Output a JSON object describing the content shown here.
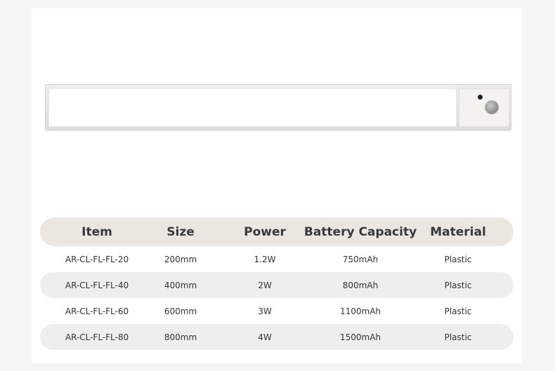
{
  "product_image": {
    "sensors": [
      "light-sensor-icon",
      "motion-sensor-icon"
    ]
  },
  "spec_table": {
    "headers": [
      "Item",
      "Size",
      "Power",
      "Battery Capacity",
      "Material"
    ],
    "rows": [
      [
        "AR-CL-FL-FL-20",
        "200mm",
        "1.2W",
        "750mAh",
        "Plastic"
      ],
      [
        "AR-CL-FL-FL-40",
        "400mm",
        "2W",
        "800mAh",
        "Plastic"
      ],
      [
        "AR-CL-FL-FL-60",
        "600mm",
        "3W",
        "1100mAh",
        "Plastic"
      ],
      [
        "AR-CL-FL-FL-80",
        "800mm",
        "4W",
        "1500mAh",
        "Plastic"
      ]
    ]
  },
  "colors": {
    "header_bg": "#ebe6e0",
    "stripe_bg": "#eeeeee",
    "page_bg": "#ffffff"
  }
}
